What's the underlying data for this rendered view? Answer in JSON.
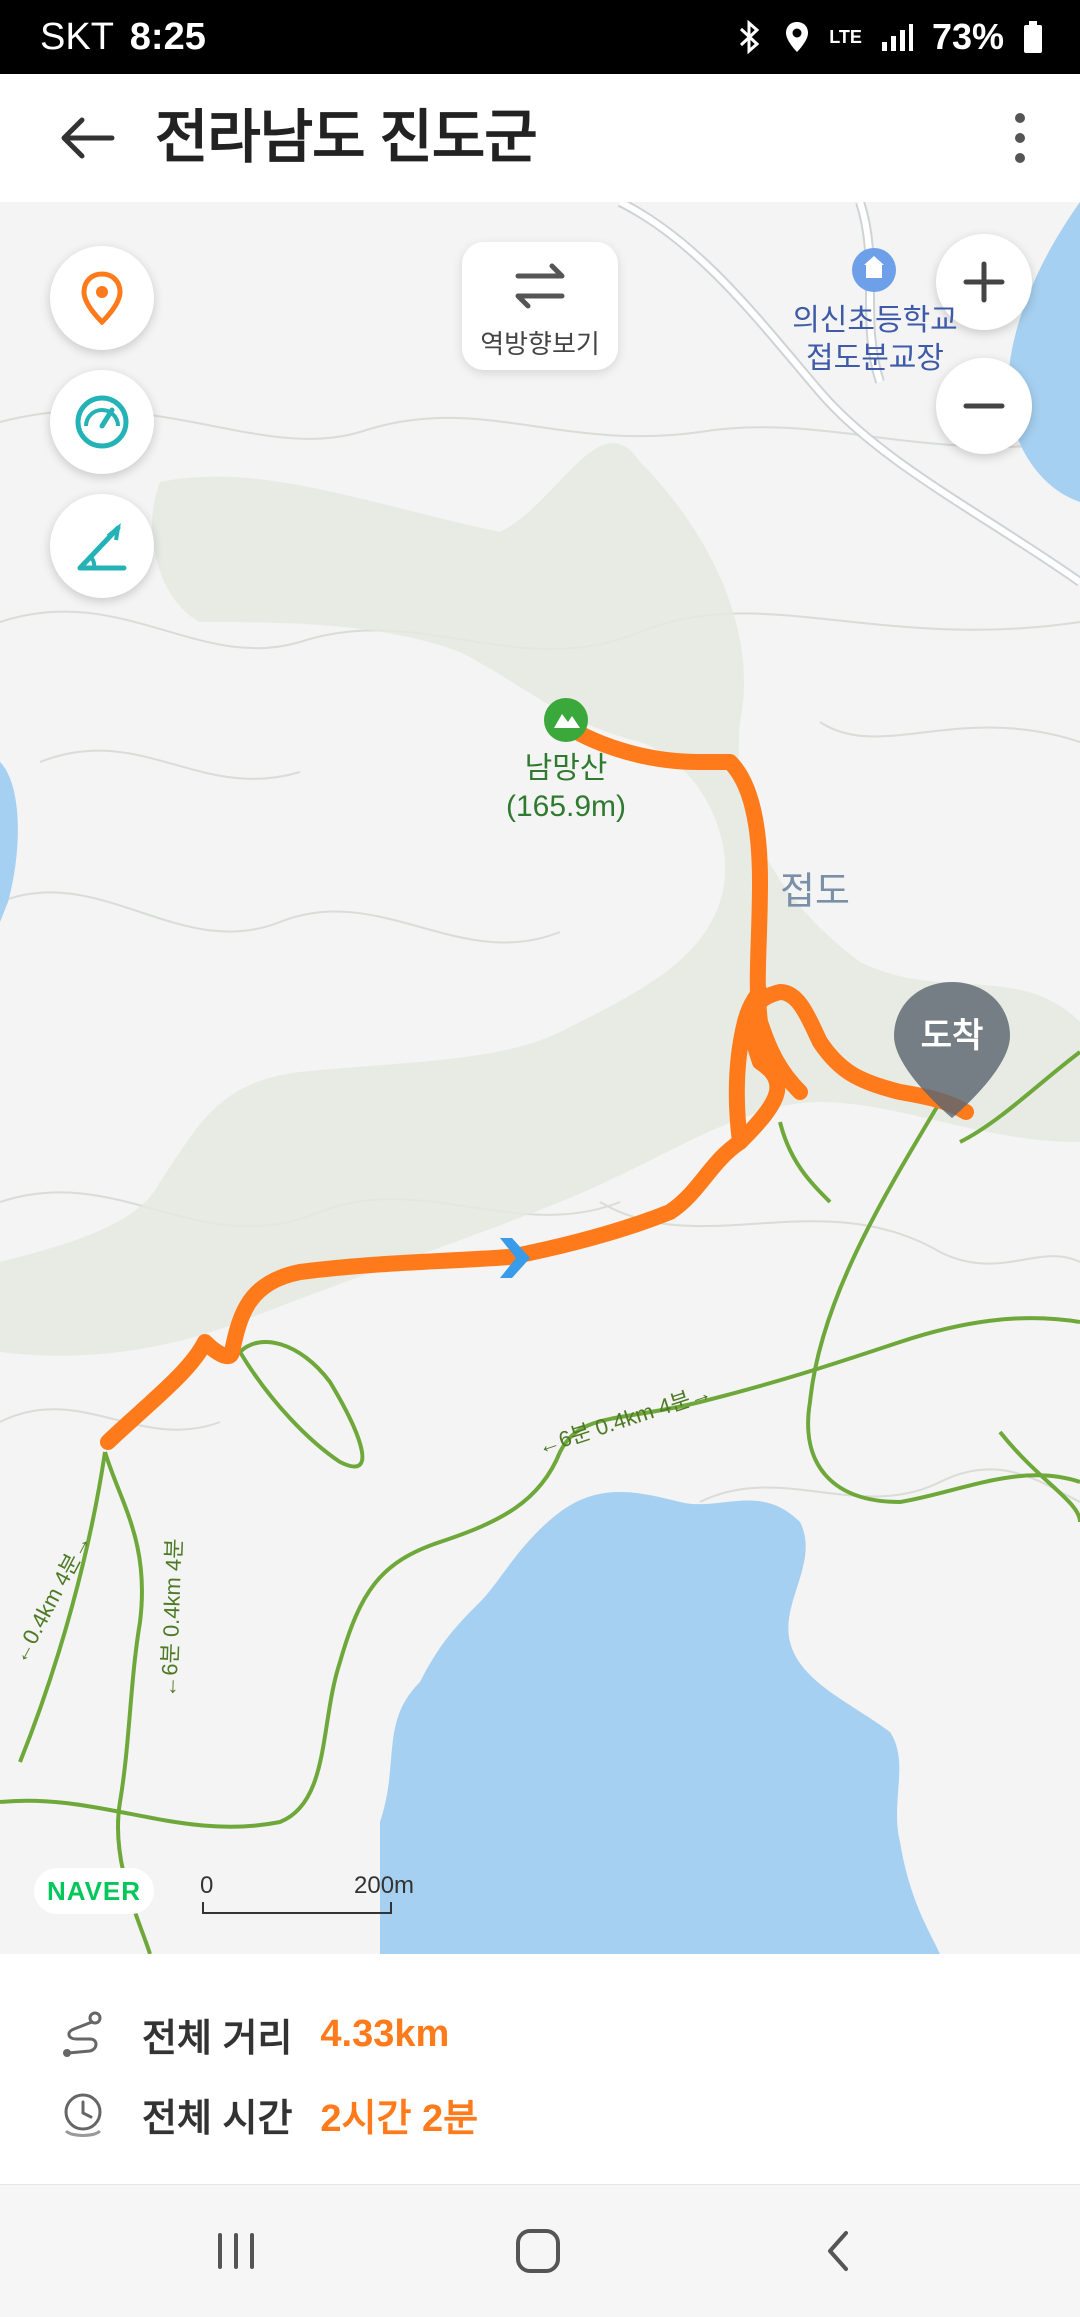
{
  "status_bar": {
    "carrier": "SKT",
    "time": "8:25",
    "network": "LTE",
    "battery": "73%"
  },
  "header": {
    "title": "전라남도 진도군",
    "back_icon": "arrow-left-icon",
    "more_icon": "more-vertical-icon"
  },
  "map": {
    "controls": {
      "location_icon": "location-pin-icon",
      "speed_icon": "speedometer-icon",
      "slope_icon": "slope-icon",
      "reverse_label": "역방향보기",
      "zoom_in_icon": "plus-icon",
      "zoom_out_icon": "minus-icon"
    },
    "labels": {
      "school_line1": "의신초등학교",
      "school_line2": "접도분교장",
      "peak_name": "남망산",
      "peak_height": "(165.9m)",
      "island": "접도",
      "arrival": "도착",
      "trail_left_1": "←0.4km 4분→",
      "trail_left_2": "←6분 0.4km 4분",
      "trail_bottom": "←6분 0.4km 4분→"
    },
    "brand": "NAVER",
    "scale": {
      "zero": "0",
      "max": "200m"
    },
    "colors": {
      "route": "#ff7a1a",
      "water": "#a6d0f1",
      "trail": "#6fa83a",
      "terrain": "#e4e9e0"
    }
  },
  "summary": {
    "distance_label": "전체 거리",
    "distance_value": "4.33km",
    "time_label": "전체 시간",
    "time_value": "2시간 2분"
  },
  "nav_bar": {
    "recent_icon": "recent-apps-icon",
    "home_icon": "home-icon",
    "back_icon": "back-chevron-icon"
  }
}
